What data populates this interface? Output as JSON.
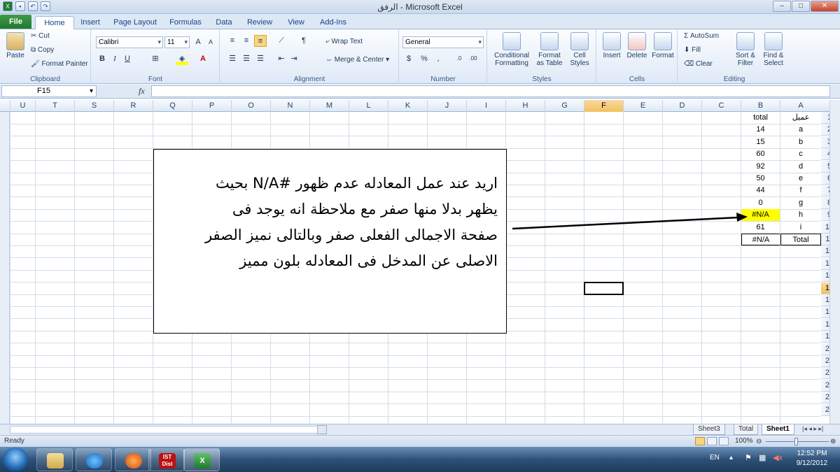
{
  "window": {
    "title": "الرفق - Microsoft Excel"
  },
  "ribbon_tabs": [
    "Home",
    "Insert",
    "Page Layout",
    "Formulas",
    "Data",
    "Review",
    "View",
    "Add-Ins"
  ],
  "file_tab": "File",
  "clipboard": {
    "paste": "Paste",
    "cut": "Cut",
    "copy": "Copy",
    "format_painter": "Format Painter",
    "label": "Clipboard"
  },
  "font": {
    "name": "Calibri",
    "size": "11",
    "label": "Font"
  },
  "alignment": {
    "wrap": "Wrap Text",
    "merge": "Merge & Center",
    "label": "Alignment"
  },
  "number": {
    "format": "General",
    "label": "Number"
  },
  "styles": {
    "conditional": "Conditional Formatting",
    "format_table": "Format as Table",
    "cell_styles": "Cell Styles",
    "label": "Styles"
  },
  "cells": {
    "insert": "Insert",
    "delete": "Delete",
    "format": "Format",
    "label": "Cells"
  },
  "editing": {
    "autosum": "AutoSum",
    "fill": "Fill",
    "clear": "Clear",
    "sort": "Sort & Filter",
    "find": "Find & Select",
    "label": "Editing"
  },
  "formula_bar": {
    "name_box": "F15",
    "fx": "fx",
    "value": ""
  },
  "columns": [
    "U",
    "T",
    "S",
    "R",
    "Q",
    "P",
    "O",
    "N",
    "M",
    "L",
    "K",
    "J",
    "I",
    "H",
    "G",
    "F",
    "E",
    "D",
    "C",
    "B",
    "A"
  ],
  "selected_column": "F",
  "rows": [
    "1",
    "2",
    "3",
    "4",
    "5",
    "6",
    "7",
    "8",
    "9",
    "10",
    "11",
    "12",
    "13",
    "14",
    "15",
    "16",
    "17",
    "18",
    "19",
    "20",
    "21",
    "22",
    "23",
    "24",
    "25"
  ],
  "selected_row": "15",
  "data_cells": {
    "B": [
      "total",
      "14",
      "15",
      "60",
      "92",
      "50",
      "44",
      "0",
      "#N/A",
      "61",
      "#N/A"
    ],
    "A": [
      "عميل",
      "a",
      "b",
      "c",
      "d",
      "e",
      "f",
      "g",
      "h",
      "i",
      "Total"
    ]
  },
  "textbox_lines": [
    "اريد عند عمل المعادله عدم ظهور #N/A بحيث",
    "يظهر بدلا منها صفر مع ملاحظة انه يوجد فى",
    "صفحة الاجمالى الفعلى صفر وبالتالى نميز الصفر",
    "الاصلى عن المدخل فى المعادله بلون مميز"
  ],
  "sheets": [
    "Sheet3",
    "Total",
    "Sheet1"
  ],
  "active_sheet": "Sheet1",
  "status": {
    "ready": "Ready",
    "zoom": "100%"
  },
  "taskbar": {
    "lang": "EN",
    "time": "12:52 PM",
    "date": "9/12/2012",
    "ist": "IST Dist"
  },
  "colors": {
    "highlight": "#ffff00",
    "selection": "#f1c15f",
    "excel_green": "#1f7a2e"
  }
}
